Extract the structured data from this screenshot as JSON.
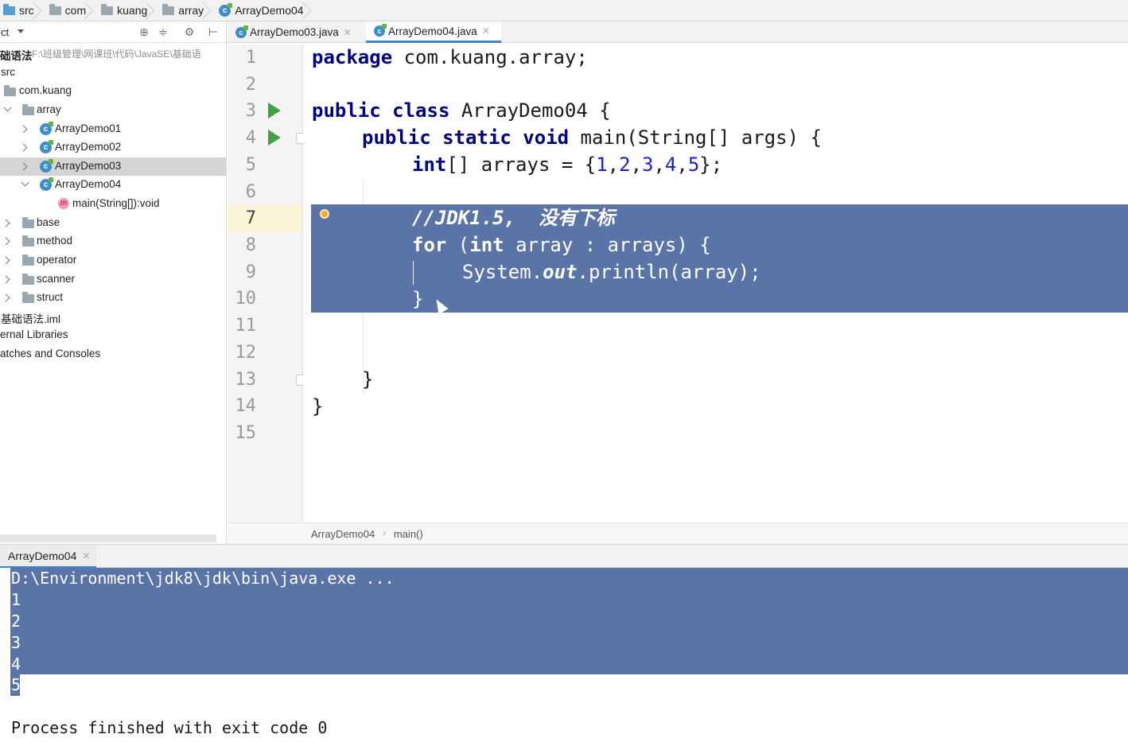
{
  "breadcrumb": [
    {
      "label": "src",
      "icon": "folder-blue-icon"
    },
    {
      "label": "com",
      "icon": "folder-icon"
    },
    {
      "label": "kuang",
      "icon": "folder-icon"
    },
    {
      "label": "array",
      "icon": "folder-icon"
    },
    {
      "label": "ArrayDemo04",
      "icon": "class-icon"
    }
  ],
  "project": {
    "title": "ct",
    "tree": [
      {
        "label": "础语法",
        "hint": "F:\\班级管理\\网课班\\代码\\JavaSE\\基础语",
        "bold": true
      },
      {
        "label": "src"
      },
      {
        "label": "com.kuang",
        "icon": "folder-icon"
      },
      {
        "label": "array",
        "icon": "folder-icon",
        "expanded": true
      },
      {
        "label": "ArrayDemo01",
        "icon": "class-icon"
      },
      {
        "label": "ArrayDemo02",
        "icon": "class-icon"
      },
      {
        "label": "ArrayDemo03",
        "icon": "class-icon",
        "selected": true
      },
      {
        "label": "ArrayDemo04",
        "icon": "class-icon",
        "expanded": true
      },
      {
        "label": "main(String[]):void",
        "icon": "method-icon"
      },
      {
        "label": "base",
        "icon": "folder-icon"
      },
      {
        "label": "method",
        "icon": "folder-icon"
      },
      {
        "label": "operator",
        "icon": "folder-icon"
      },
      {
        "label": "scanner",
        "icon": "folder-icon"
      },
      {
        "label": "struct",
        "icon": "folder-icon"
      },
      {
        "label": "基础语法.iml"
      },
      {
        "label": "ernal Libraries"
      },
      {
        "label": "atches and Consoles"
      }
    ]
  },
  "editor": {
    "tabs": [
      {
        "label": "ArrayDemo03.java",
        "active": false
      },
      {
        "label": "ArrayDemo04.java",
        "active": true
      }
    ],
    "line_numbers": [
      "1",
      "2",
      "3",
      "4",
      "5",
      "6",
      "7",
      "8",
      "9",
      "10",
      "11",
      "12",
      "13",
      "14",
      "15"
    ],
    "current_line": 7,
    "code": {
      "l1_kw": "package",
      "l1_rest": " com.kuang.array;",
      "l3_kw": "public class",
      "l3_rest": " ArrayDemo04 {",
      "l4_kw": "public static void",
      "l4_rest": " main(String[] args) {",
      "l5_kw": "int",
      "l5_a": "[] arrays = {",
      "n1": "1",
      "n2": "2",
      "n3": "3",
      "n4": "4",
      "n5": "5",
      "l5_end": "};",
      "l7_comment": "//JDK1.5,  没有下标",
      "l8_kw": "for",
      "l8_b": " (",
      "l8_kw2": "int",
      "l8_rest": " array : arrays) {",
      "l9_a": "System.",
      "l9_out": "out",
      "l9_b": ".println(array);",
      "l10": "}",
      "l13": "}",
      "l14": "}"
    },
    "breadcrumb": [
      "ArrayDemo04",
      "main()"
    ]
  },
  "run": {
    "tab_label": "ArrayDemo04",
    "console": [
      "D:\\Environment\\jdk8\\jdk\\bin\\java.exe ...",
      "1",
      "2",
      "3",
      "4",
      "5",
      "",
      "Process finished with exit code 0"
    ]
  },
  "colors": {
    "selection": "#5b74a7",
    "keyword": "#000080",
    "number": "#1c1cd8",
    "run_icon": "#43a047"
  }
}
